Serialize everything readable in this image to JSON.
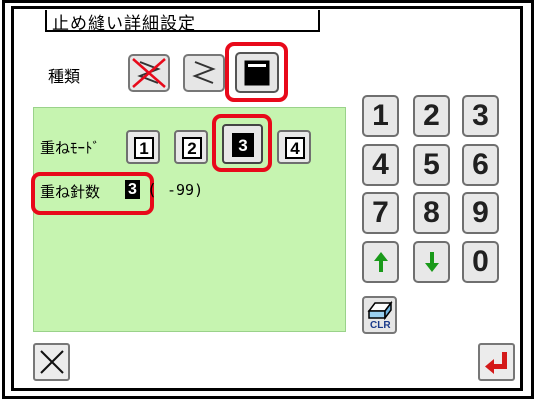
{
  "title": "止め縫い詳細設定",
  "type_label": "種類",
  "mode_label": "重ねﾓｰﾄﾞ",
  "stitch_label": "重ね針数",
  "stitch_value": "3",
  "stitch_range_open": "(",
  "stitch_range": "-99)",
  "modes": [
    "1",
    "2",
    "3",
    "4"
  ],
  "selected_mode": "3",
  "keypad": [
    "1",
    "2",
    "3",
    "4",
    "5",
    "6",
    "7",
    "8",
    "9",
    "0"
  ],
  "clr_label": "CLR",
  "colors": {
    "highlight": "#e8091a",
    "panel": "#c6f4b0",
    "arrow": "#1a9a1a"
  }
}
